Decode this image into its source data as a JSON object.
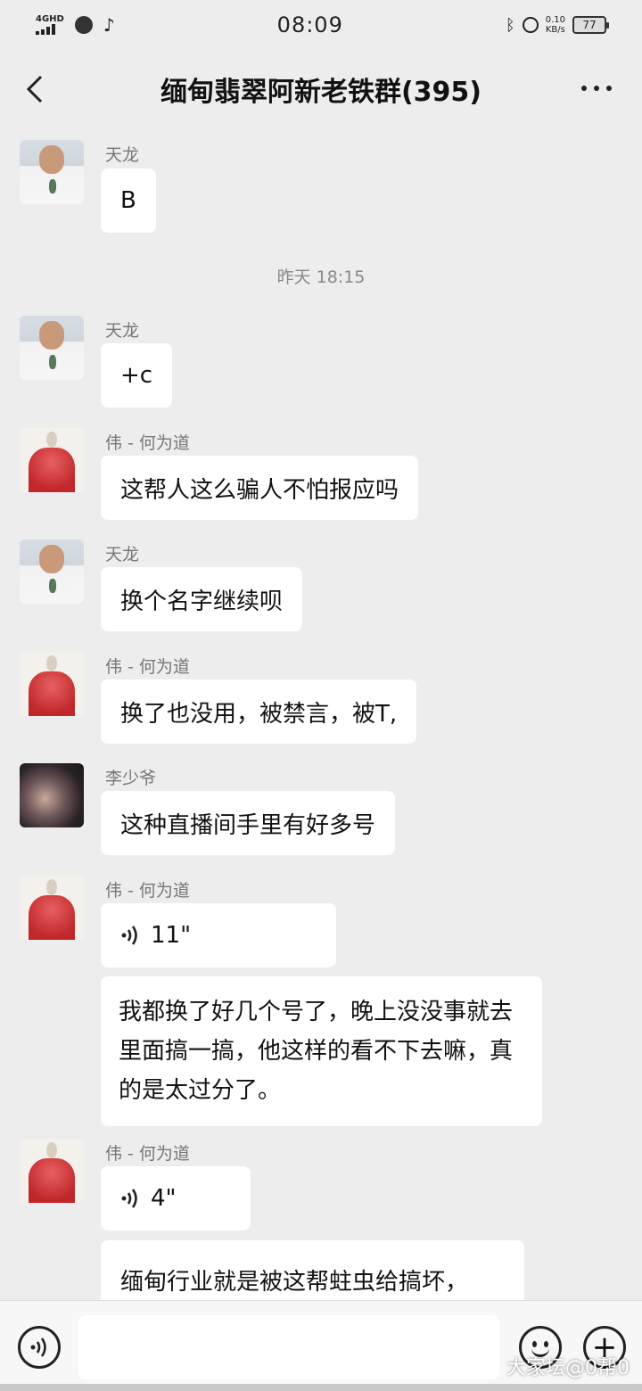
{
  "status_bar": {
    "network": "4GHD",
    "time": "08:09",
    "net_speed_value": "0.10",
    "net_speed_unit": "KB/s",
    "battery": "77"
  },
  "header": {
    "title": "缅甸翡翠阿新老铁群(395)"
  },
  "timestamp": "昨天 18:15",
  "messages": [
    {
      "sender": "天龙",
      "text": "B"
    },
    {
      "sender": "天龙",
      "text": "+c"
    },
    {
      "sender": "伟 - 何为道",
      "text": "这帮人这么骗人不怕报应吗"
    },
    {
      "sender": "天龙",
      "text": "换个名字继续呗"
    },
    {
      "sender": "伟 - 何为道",
      "text": "换了也没用，被禁言，被T,"
    },
    {
      "sender": "李少爷",
      "text": "这种直播间手里有好多号"
    },
    {
      "sender": "伟 - 何为道",
      "voice": "11\"",
      "text": "我都换了好几个号了，晚上没没事就去里面搞一搞，他这样的看不下去嘛，真的是太过分了。"
    },
    {
      "sender": "伟 - 何为道",
      "voice": "4\"",
      "text": "缅甸行业就是被这帮蛀虫给搞坏，"
    }
  ],
  "input": {
    "value": "",
    "placeholder": ""
  },
  "watermark": "大家坛@0帮0"
}
